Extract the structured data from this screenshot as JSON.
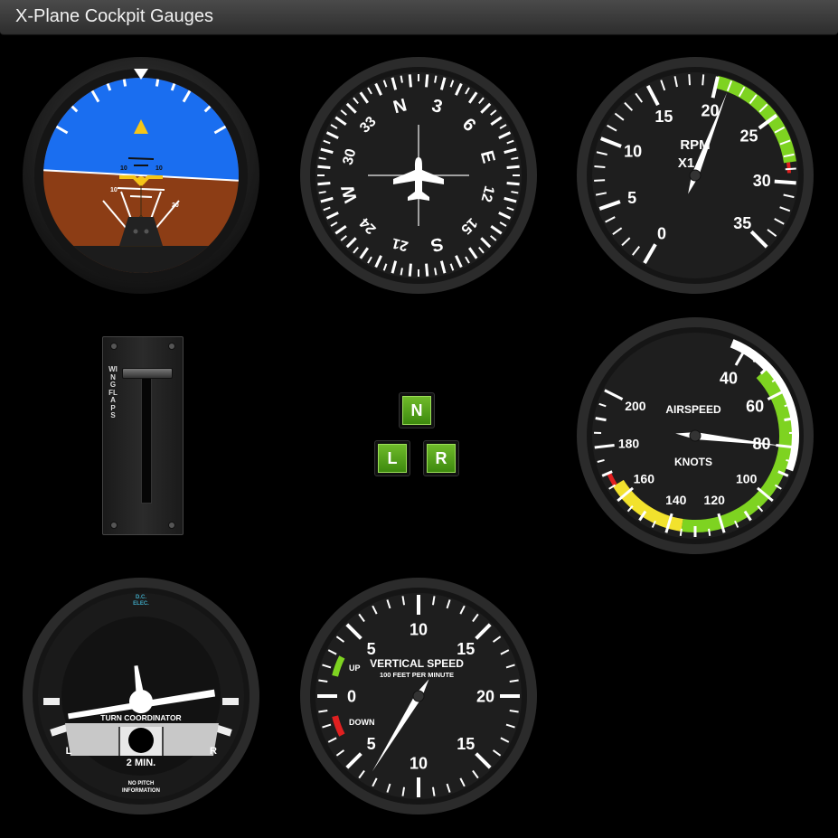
{
  "window": {
    "title": "X-Plane Cockpit Gauges"
  },
  "attitude": {
    "pitch_labels": [
      "10",
      "10",
      "10",
      "20"
    ]
  },
  "heading": {
    "labels": [
      "N",
      "3",
      "6",
      "E",
      "12",
      "15",
      "S",
      "21",
      "24",
      "W",
      "30",
      "33"
    ]
  },
  "rpm": {
    "labels": [
      "0",
      "5",
      "10",
      "15",
      "20",
      "25",
      "30",
      "35"
    ],
    "title": "RPM",
    "multiplier": "X1",
    "value": 21
  },
  "flaps": {
    "label": "WING FLAPS"
  },
  "gear": {
    "nose": "N",
    "left": "L",
    "right": "R",
    "color": "#5aa51c"
  },
  "airspeed": {
    "labels": [
      "40",
      "60",
      "80",
      "100",
      "120",
      "140",
      "160",
      "180",
      "200"
    ],
    "title": "AIRSPEED",
    "unit": "KNOTS",
    "value": 80
  },
  "turn": {
    "title": "TURN COORDINATOR",
    "left": "L",
    "right": "R",
    "rate": "2 MIN.",
    "note_line1": "NO PITCH",
    "note_line2": "INFORMATION",
    "power_line1": "D.C.",
    "power_line2": "ELEC."
  },
  "vsi": {
    "title": "VERTICAL SPEED",
    "subtitle": "100 FEET PER MINUTE",
    "up": "UP",
    "down": "DOWN",
    "labels": [
      "0",
      "5",
      "10",
      "15",
      "20",
      "15",
      "10",
      "5"
    ]
  },
  "colors": {
    "sky": "#1a6ef0",
    "ground": "#8c3d15",
    "green_arc": "#7ed321",
    "yellow_arc": "#f2e22d",
    "red_line": "#e02020",
    "white_arc": "#ffffff",
    "pointer": "#ffffff",
    "aircraft_symbol": "#f5c518"
  }
}
